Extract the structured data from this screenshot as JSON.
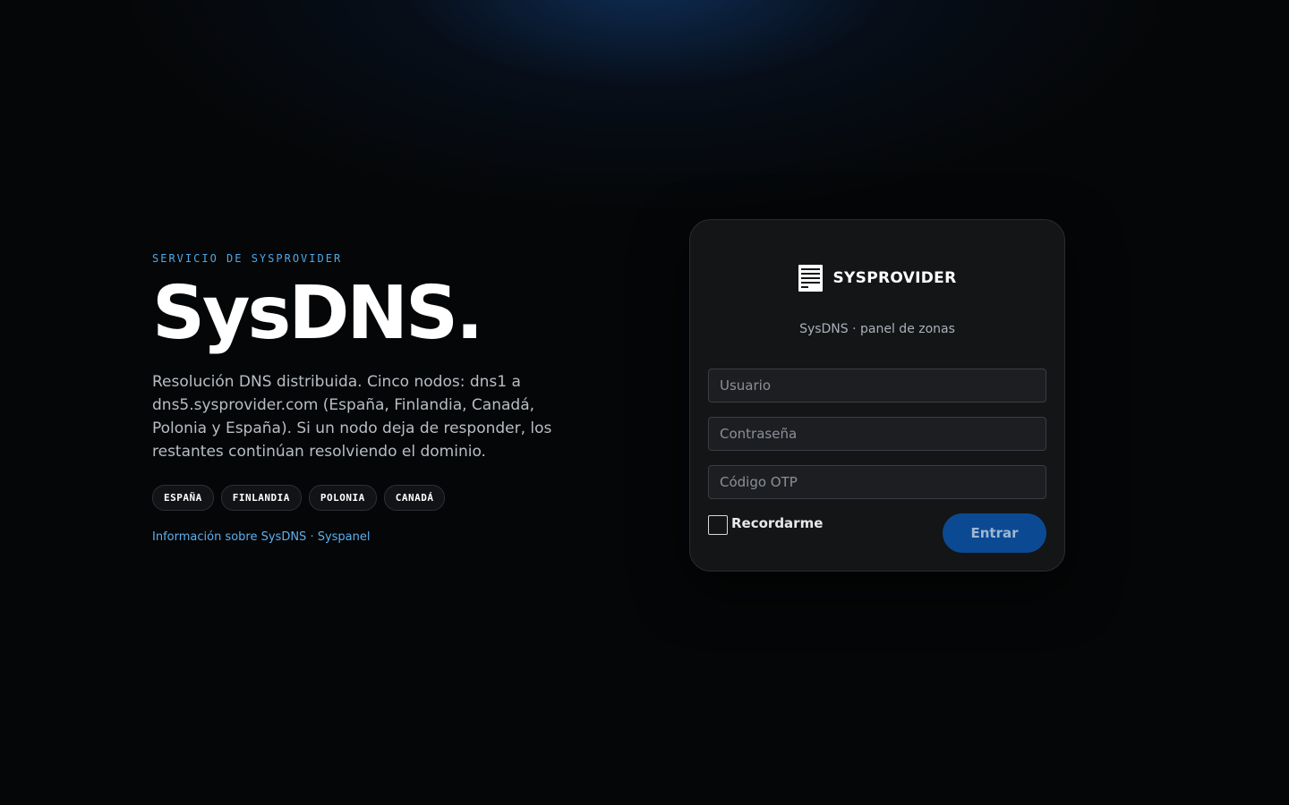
{
  "hero": {
    "eyebrow": "SERVICIO DE SYSPROVIDER",
    "title": "SysDNS.",
    "description": "Resolución DNS distribuida. Cinco nodos: dns1 a dns5.sysprovider.com (España, Finlandia, Canadá, Polonia y España). Si un nodo deja de responder, los restantes continúan resolviendo el dominio.",
    "chips": [
      "ESPAÑA",
      "FINLANDIA",
      "POLONIA",
      "CANADÁ"
    ],
    "info_link": "Información sobre SysDNS · Syspanel"
  },
  "login": {
    "brand_icon": "server-stack-icon",
    "brand_name": "SYSPROVIDER",
    "subtitle": "SysDNS · panel de zonas",
    "username_placeholder": "Usuario",
    "password_placeholder": "Contraseña",
    "otp_placeholder": "Código OTP",
    "remember_label": "Recordarme",
    "remember_checked": false,
    "submit_label": "Entrar"
  },
  "colors": {
    "accent": "#4fa8e8",
    "link": "#5cb0ef",
    "button": "#0b4a93",
    "background": "#050607",
    "card": "#141517"
  }
}
